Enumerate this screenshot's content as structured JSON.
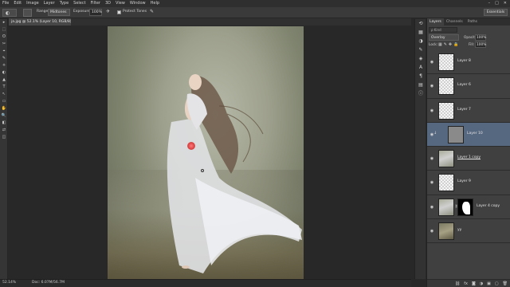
{
  "menu": {
    "items": [
      "File",
      "Edit",
      "Image",
      "Layer",
      "Type",
      "Select",
      "Filter",
      "3D",
      "View",
      "Window",
      "Help"
    ],
    "window_controls": [
      "–",
      "□",
      "✕"
    ]
  },
  "options_bar": {
    "tool_icon": "dodge-tool-icon",
    "brush_size": "65",
    "range_label": "Range:",
    "range_value": "Midtones",
    "exposure_label": "Exposure:",
    "exposure_value": "100%",
    "protect_tones_label": "Protect Tones",
    "protect_tones_checked": true,
    "workspace": "Essentials"
  },
  "tools": [
    "▸",
    "⬚",
    "ʘ",
    "✂",
    "⌖",
    "✎",
    "⟡",
    "◐",
    "▲",
    "T",
    "↖",
    "▭",
    "✋",
    "🔍",
    "◧",
    "⇄",
    "◫"
  ],
  "document": {
    "tab_title": "ja.jpg @ 52.1% (Layer 10, RGB/8) *"
  },
  "status": {
    "zoom": "52.14%",
    "doc_info": "Doc: 6.07M/56.7M"
  },
  "layers_panel": {
    "tabs": [
      "Layers",
      "Channels",
      "Paths"
    ],
    "kind_filter": "ρ Kind",
    "blend_mode": "Overlay",
    "opacity_label": "Opacity:",
    "opacity_value": "100%",
    "lock_label": "Lock:",
    "fill_label": "Fill:",
    "fill_value": "100%",
    "layers": [
      {
        "name": "Layer 8"
      },
      {
        "name": "Layer 6"
      },
      {
        "name": "Layer 7"
      },
      {
        "name": "Layer 10"
      },
      {
        "name": "Layer 1 copy"
      },
      {
        "name": "Layer 9"
      },
      {
        "name": "Layer 4 copy"
      },
      {
        "name": "yy"
      }
    ],
    "footer_icons": [
      "⛓",
      "fx",
      "◙",
      "◑",
      "▣",
      "▢",
      "🗑"
    ]
  },
  "colors": {
    "selected_layer": "#566780",
    "panel_bg": "#404040",
    "app_bg": "#282828"
  }
}
